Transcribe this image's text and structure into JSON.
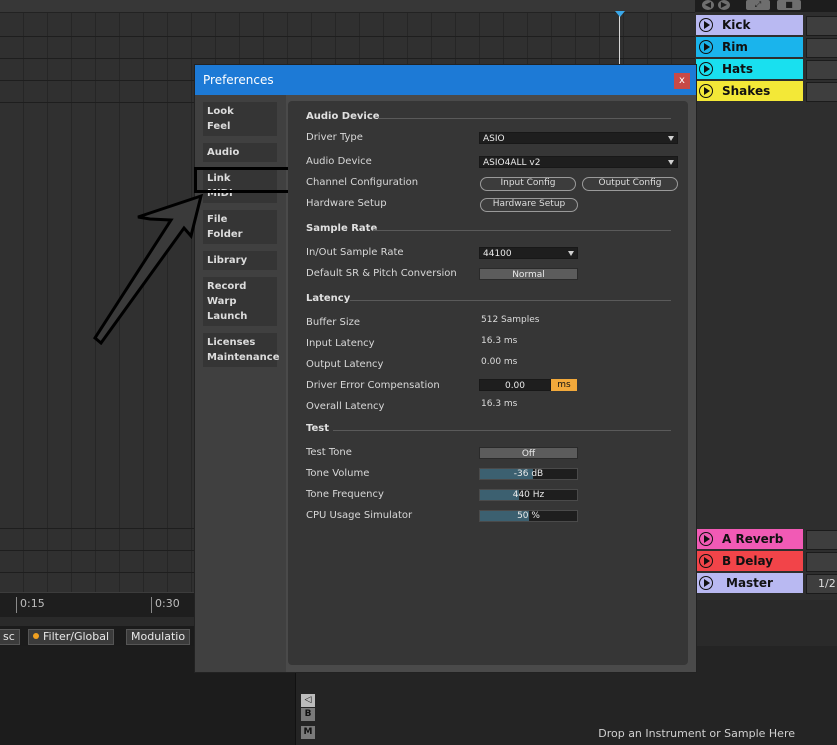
{
  "colors": {
    "dialog_title_bar": "#1d7ad6",
    "close_button": "#c84a47",
    "accent_orange": "#f2a93b",
    "track_kick": "#b9b9f2",
    "track_rim": "#1ab4ec",
    "track_hats": "#19e0ef",
    "track_shakes": "#f3e837",
    "track_a_reverb": "#f15ab5",
    "track_b_delay": "#f24449",
    "track_master": "#b9b9f2"
  },
  "timeline": {
    "marks": [
      "0:15",
      "0:30"
    ]
  },
  "device_tabs": {
    "tab1": "sc",
    "tab2": "Filter/Global",
    "tab3": "Modulatio"
  },
  "lower_buttons": {
    "b": "B",
    "m": "M"
  },
  "browser": {
    "drop_hint": "Drop an Instrument or Sample Here"
  },
  "top_icons": {
    "back": "back-icon",
    "forward": "forward-icon",
    "expand": "expand-icon",
    "lock": "lock-icon"
  },
  "tracks": {
    "top": [
      "Kick",
      "Rim",
      "Hats",
      "Shakes"
    ],
    "returns": [
      "A Reverb",
      "B Delay"
    ],
    "master": "Master",
    "master_side": "1/2"
  },
  "dialog": {
    "title": "Preferences",
    "close_glyph": "x",
    "sidebar": [
      {
        "line1": "Look",
        "line2": "Feel"
      },
      {
        "line1": "Audio",
        "line2": ""
      },
      {
        "line1": "Link",
        "line2": "MIDI"
      },
      {
        "line1": "File",
        "line2": "Folder"
      },
      {
        "line1": "Library",
        "line2": ""
      },
      {
        "line1": "Record",
        "line2": "Warp",
        "line3": "Launch"
      },
      {
        "line1": "Licenses",
        "line2": "Maintenance"
      }
    ],
    "audio_device": {
      "header": "Audio Device",
      "driver_type_label": "Driver Type",
      "driver_type_value": "ASIO",
      "audio_device_label": "Audio Device",
      "audio_device_value": "ASIO4ALL v2",
      "channel_config_label": "Channel Configuration",
      "input_config": "Input Config",
      "output_config": "Output Config",
      "hardware_setup_label": "Hardware Setup",
      "hardware_setup_button": "Hardware Setup"
    },
    "sample_rate": {
      "header": "Sample Rate",
      "in_out_label": "In/Out Sample Rate",
      "in_out_value": "44100",
      "default_sr_label": "Default SR & Pitch Conversion",
      "default_sr_value": "Normal"
    },
    "latency": {
      "header": "Latency",
      "buffer_size_label": "Buffer Size",
      "buffer_size_value": "512 Samples",
      "input_latency_label": "Input Latency",
      "input_latency_value": "16.3 ms",
      "output_latency_label": "Output Latency",
      "output_latency_value": "0.00 ms",
      "driver_error_label": "Driver Error Compensation",
      "driver_error_value": "0.00",
      "driver_error_unit": "ms",
      "overall_latency_label": "Overall Latency",
      "overall_latency_value": "16.3 ms"
    },
    "test": {
      "header": "Test",
      "test_tone_label": "Test Tone",
      "test_tone_value": "Off",
      "tone_volume_label": "Tone Volume",
      "tone_volume_value": "-36 dB",
      "tone_volume_fill": 0.55,
      "tone_frequency_label": "Tone Frequency",
      "tone_frequency_value": "440 Hz",
      "tone_frequency_fill": 0.4,
      "cpu_sim_label": "CPU Usage Simulator",
      "cpu_sim_value": "50 %",
      "cpu_sim_fill": 0.5
    }
  }
}
